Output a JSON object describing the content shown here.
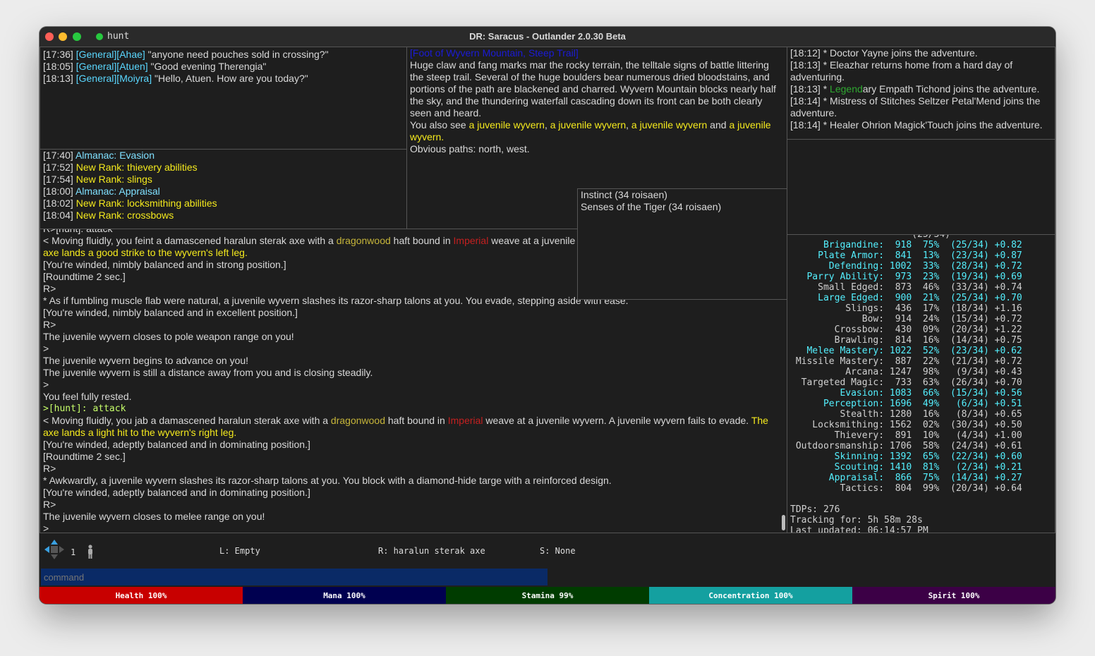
{
  "titlebar": {
    "tab": "hunt",
    "title": "DR: Saracus - Outlander 2.0.30 Beta"
  },
  "chat": [
    {
      "ts": "[17:36]",
      "ch": "[General][Ahae]",
      "msg": " \"anyone need pouches sold in crossing?\""
    },
    {
      "ts": "[18:05]",
      "ch": "[General][Atuen]",
      "msg": " \"Good evening Therengia\""
    },
    {
      "ts": "[18:13]",
      "ch": "[General][Moiyra]",
      "msg": " \"Hello, Atuen. How are you today?\""
    }
  ],
  "logs": [
    {
      "ts": "[17:40]",
      "msg": " Almanac: Evasion",
      "color": "#7fe0ff"
    },
    {
      "ts": "[17:52]",
      "msg": " New Rank: thievery abilities",
      "color": "#f5ea1d"
    },
    {
      "ts": "[17:54]",
      "msg": " New Rank: slings",
      "color": "#f5ea1d"
    },
    {
      "ts": "[18:00]",
      "msg": " Almanac: Appraisal",
      "color": "#7fe0ff"
    },
    {
      "ts": "[18:02]",
      "msg": " New Rank: locksmithing abilities",
      "color": "#f5ea1d"
    },
    {
      "ts": "[18:04]",
      "msg": " New Rank: crossbows",
      "color": "#f5ea1d"
    }
  ],
  "room": {
    "title": "[Foot of Wyvern Mountain, Steep Trail]",
    "desc": "Huge claw and fang marks mar the rocky terrain, the telltale signs of battle littering the steep trail.  Several of the huge boulders bear numerous dried bloodstains, and portions of the path are blackened and charred.  Wyvern Mountain blocks nearly half the sky, and the thundering waterfall cascading down its front can be both clearly seen and heard.",
    "also_prefix": "You also see ",
    "also_items": [
      "a juvenile wyvern",
      "a juvenile wyvern",
      "a juvenile wyvern",
      "a juvenile wyvern"
    ],
    "sep1": ", ",
    "sep2": ", ",
    "sep3": " and ",
    "end": ".",
    "paths": "Obvious paths: north, west."
  },
  "arrivals": [
    {
      "t": "[18:12] * Doctor Yayne joins the adventure."
    },
    {
      "t": "[18:13] * Eleazhar returns home from a hard day of adventuring."
    },
    {
      "t": "[18:13] * ",
      "g": "Legend",
      "r": "ary Empath Tichond joins the adventure."
    },
    {
      "t": "[18:14] * Mistress of Stitches Seltzer Petal'Mend joins the adventure."
    },
    {
      "t": "[18:14] * Healer Ohrion Magick'Touch joins the adventure."
    }
  ],
  "spells": [
    "Instinct  (34 roisaen)",
    "Senses of the Tiger  (34 roisaen)"
  ],
  "game": {
    "l0": "R>[hunt]: attack",
    "l1a": "< Moving fluidly, you feint a damascened haralun sterak axe with a ",
    "dw": "dragonwood",
    "l1b": " haft bound in ",
    "imp": "Imperial",
    "l1c": " weave at a juvenile",
    "l2": "axe lands a good strike to the wyvern's left leg.",
    "l3": "[You're winded, nimbly balanced and in strong position.]",
    "l4": "[Roundtime 2 sec.]",
    "l5": "R>",
    "l6": "* As if fumbling muscle flab were natural, a juvenile wyvern slashes its razor-sharp talons at you.  You evade, stepping aside with ease.",
    "l7": "[You're winded, nimbly balanced and in excellent position.]",
    "l8": "R>",
    "l9": "The juvenile wyvern closes to pole weapon range on you!",
    "l10": ">",
    "l11": "The juvenile wyvern begins to advance on you!",
    "l12": "The juvenile wyvern is still a distance away from you and is closing steadily.",
    "l13": ">",
    "l14": "You feel fully rested.",
    "l15": ">[hunt]: attack",
    "l16a": "< Moving fluidly, you jab a damascened haralun sterak axe with a ",
    "l16b": " haft bound in ",
    "l16c": " weave at a juvenile wyvern.  A juvenile wyvern fails to evade.  ",
    "l16d": "The",
    "l17": "axe lands a light hit to the wyvern's right leg.",
    "l18": "[You're winded, adeptly balanced and in dominating position.]",
    "l19": "[Roundtime 2 sec.]",
    "l20": "R>",
    "l21": "* Awkwardly, a juvenile wyvern slashes its razor-sharp talons at you.  You block with a diamond-hide targe with a reinforced design.",
    "l22": "[You're winded, adeptly balanced and in dominating position.]",
    "l23": "R>",
    "l24": "The juvenile wyvern closes to melee range on you!",
    "l25": ">"
  },
  "skills": {
    "top_partial": "(25/34)",
    "rows": [
      {
        "n": "Brigandine:",
        "v": "918",
        "p": "75%",
        "r": "(25/34)",
        "d": "+0.82",
        "hl": true
      },
      {
        "n": "Plate Armor:",
        "v": "841",
        "p": "13%",
        "r": "(23/34)",
        "d": "+0.87",
        "hl": true
      },
      {
        "n": "Defending:",
        "v": "1002",
        "p": "33%",
        "r": "(28/34)",
        "d": "+0.72",
        "hl": true
      },
      {
        "n": "Parry Ability:",
        "v": "973",
        "p": "23%",
        "r": "(19/34)",
        "d": "+0.69",
        "hl": true
      },
      {
        "n": "Small Edged:",
        "v": "873",
        "p": "46%",
        "r": "(33/34)",
        "d": "+0.74",
        "hl": false
      },
      {
        "n": "Large Edged:",
        "v": "900",
        "p": "21%",
        "r": "(25/34)",
        "d": "+0.70",
        "hl": true
      },
      {
        "n": "Slings:",
        "v": "436",
        "p": "17%",
        "r": "(18/34)",
        "d": "+1.16",
        "hl": false
      },
      {
        "n": "Bow:",
        "v": "914",
        "p": "24%",
        "r": "(15/34)",
        "d": "+0.72",
        "hl": false
      },
      {
        "n": "Crossbow:",
        "v": "430",
        "p": "09%",
        "r": "(20/34)",
        "d": "+1.22",
        "hl": false
      },
      {
        "n": "Brawling:",
        "v": "814",
        "p": "16%",
        "r": "(14/34)",
        "d": "+0.75",
        "hl": false
      },
      {
        "n": "Melee Mastery:",
        "v": "1022",
        "p": "52%",
        "r": "(23/34)",
        "d": "+0.62",
        "hl": true
      },
      {
        "n": "Missile Mastery:",
        "v": "887",
        "p": "22%",
        "r": "(21/34)",
        "d": "+0.72",
        "hl": false
      },
      {
        "n": "Arcana:",
        "v": "1247",
        "p": "98%",
        "r": "(9/34)",
        "d": "+0.43",
        "hl": false
      },
      {
        "n": "Targeted Magic:",
        "v": "733",
        "p": "63%",
        "r": "(26/34)",
        "d": "+0.70",
        "hl": false
      },
      {
        "n": "Evasion:",
        "v": "1083",
        "p": "66%",
        "r": "(15/34)",
        "d": "+0.56",
        "hl": true
      },
      {
        "n": "Perception:",
        "v": "1696",
        "p": "49%",
        "r": "(6/34)",
        "d": "+0.51",
        "hl": true
      },
      {
        "n": "Stealth:",
        "v": "1280",
        "p": "16%",
        "r": "(8/34)",
        "d": "+0.65",
        "hl": false
      },
      {
        "n": "Locksmithing:",
        "v": "1562",
        "p": "02%",
        "r": "(30/34)",
        "d": "+0.50",
        "hl": false
      },
      {
        "n": "Thievery:",
        "v": "891",
        "p": "10%",
        "r": "(4/34)",
        "d": "+1.00",
        "hl": false
      },
      {
        "n": "Outdoorsmanship:",
        "v": "1706",
        "p": "58%",
        "r": "(24/34)",
        "d": "+0.61",
        "hl": false
      },
      {
        "n": "Skinning:",
        "v": "1392",
        "p": "65%",
        "r": "(22/34)",
        "d": "+0.60",
        "hl": true
      },
      {
        "n": "Scouting:",
        "v": "1410",
        "p": "81%",
        "r": "(2/34)",
        "d": "+0.21",
        "hl": true
      },
      {
        "n": "Appraisal:",
        "v": "866",
        "p": "75%",
        "r": "(14/34)",
        "d": "+0.27",
        "hl": true
      },
      {
        "n": "Tactics:",
        "v": "804",
        "p": "99%",
        "r": "(20/34)",
        "d": "+0.64",
        "hl": false
      }
    ],
    "tdps": "TDPs: 276",
    "tracking": "Tracking for: 5h 58m 28s",
    "updated": "Last updated: 06:14:57 PM"
  },
  "status": {
    "count": "1",
    "left": "L: Empty",
    "right": "R: haralun sterak axe",
    "spell": "S: None"
  },
  "input": {
    "placeholder": "command"
  },
  "vitals": [
    {
      "label": "Health 100%",
      "color": "#c80000"
    },
    {
      "label": "Mana 100%",
      "color": "#000050"
    },
    {
      "label": "Stamina 99%",
      "color": "#003c00"
    },
    {
      "label": "Concentration 100%",
      "color": "#14a0a0"
    },
    {
      "label": "Spirit 100%",
      "color": "#3c0046"
    }
  ]
}
